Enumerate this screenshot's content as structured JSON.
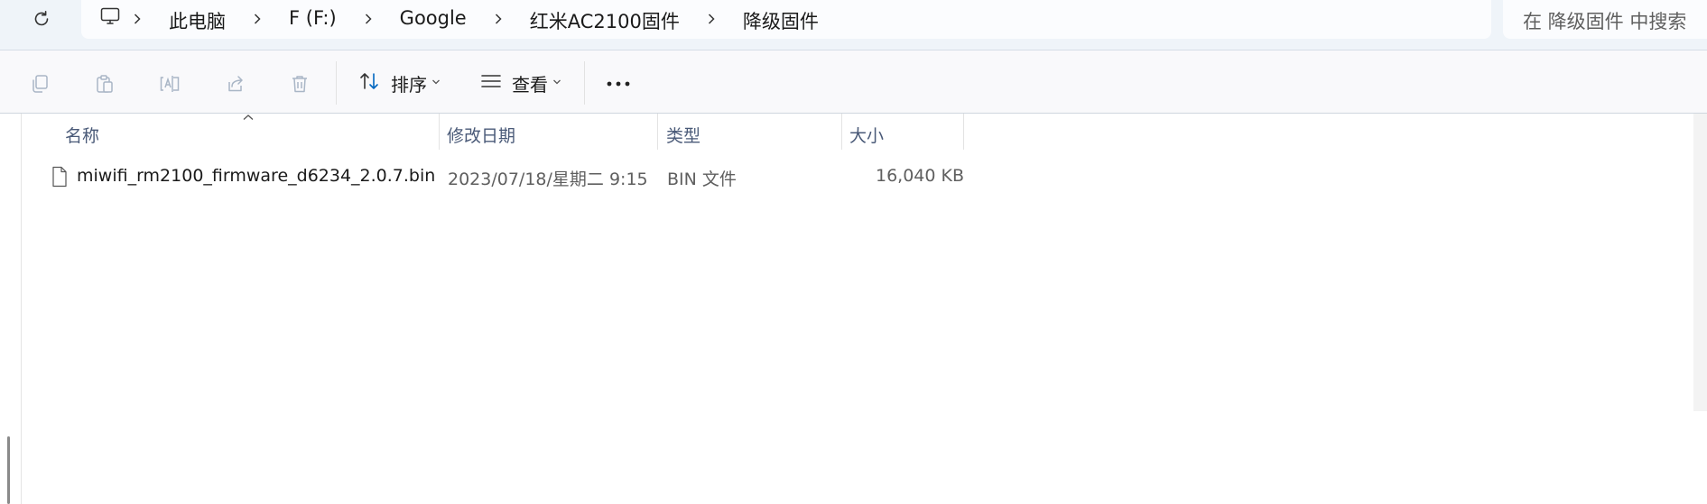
{
  "window": {
    "breadcrumb": [
      "此电脑",
      "F (F:)",
      "Google",
      "红米AC2100固件",
      "降级固件"
    ],
    "search_placeholder": "在 降级固件 中搜索"
  },
  "toolbar": {
    "sort_label": "排序",
    "view_label": "查看",
    "icons": [
      "copy-icon",
      "paste-icon",
      "rename-icon",
      "share-icon",
      "delete-icon",
      "sort-icon",
      "view-icon",
      "more-icon"
    ]
  },
  "columns": {
    "name": "名称",
    "modified": "修改日期",
    "type": "类型",
    "size": "大小"
  },
  "files": [
    {
      "name": "miwifi_rm2100_firmware_d6234_2.0.7.bin",
      "modified": "2023/07/18/星期二 9:15",
      "type": "BIN 文件",
      "size": "16,040 KB"
    }
  ],
  "colors": {
    "accent": "#0067c0",
    "topbar_bg": "#eff4f9",
    "header_text": "#4a5a78"
  }
}
